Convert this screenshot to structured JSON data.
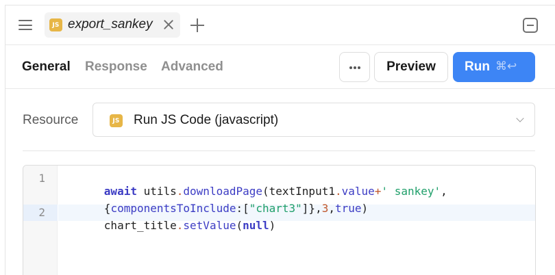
{
  "tab": {
    "icon_text": "JS",
    "label": "export_sankey"
  },
  "toolbar": {
    "tabs": [
      {
        "label": "General",
        "active": true
      },
      {
        "label": "Response",
        "active": false
      },
      {
        "label": "Advanced",
        "active": false
      }
    ],
    "more_label": "•••",
    "preview_label": "Preview",
    "run_label": "Run",
    "run_shortcut": "⌘↩"
  },
  "resource": {
    "label": "Resource",
    "icon_text": "JS",
    "value": "Run JS Code (javascript)"
  },
  "editor": {
    "lines": [
      {
        "number": "1",
        "text_a": "await utils.downloadPage(textInput1.value+' sankey',",
        "text_b": "{componentsToInclude:[\"chart3\"]},3,true)"
      },
      {
        "number": "2",
        "text": "chart_title.setValue(null)"
      }
    ]
  },
  "icons": {
    "menu": "hamburger-icon",
    "close": "close-icon",
    "add": "plus-icon",
    "collapse": "collapse-panel-icon",
    "chevron": "chevron-down-icon"
  },
  "colors": {
    "accent": "#3d85f5",
    "js_badge": "#e7b647",
    "keyword": "#3c3cc4",
    "string": "#1f9f6a",
    "number": "#c0582d"
  }
}
